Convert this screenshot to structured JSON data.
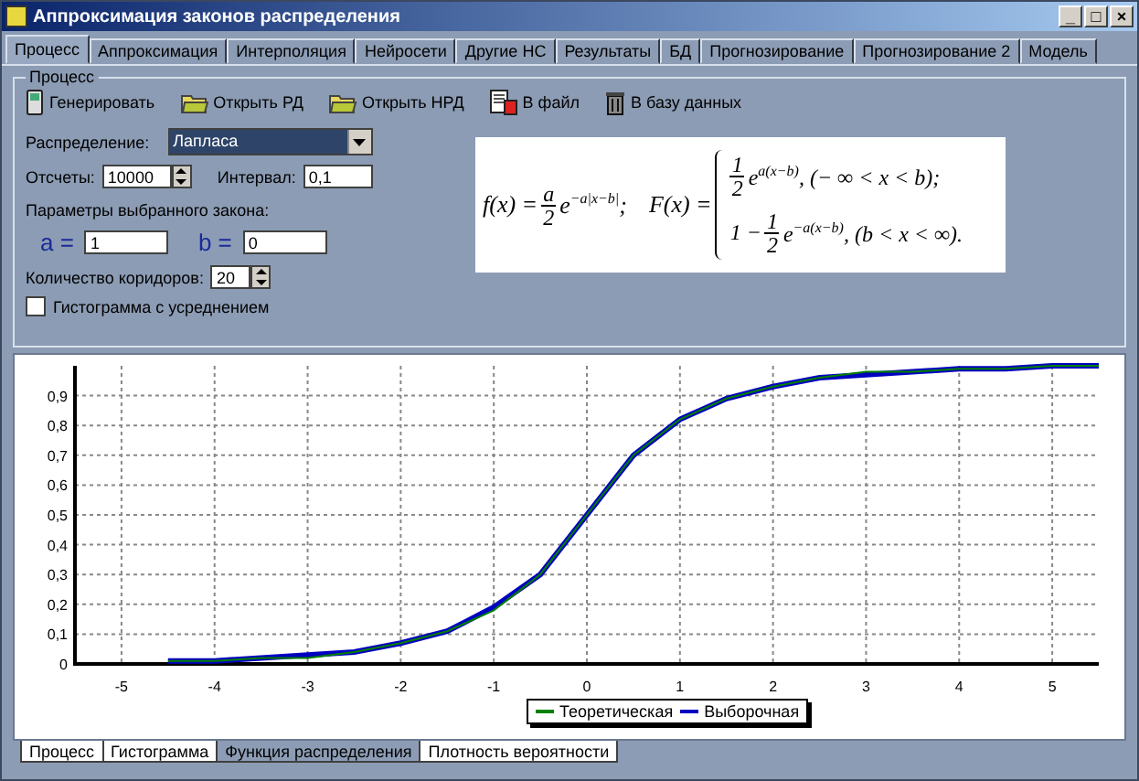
{
  "window": {
    "title": "Аппроксимация законов распределения",
    "controls": [
      "_",
      "□",
      "×"
    ]
  },
  "tabs": [
    {
      "label": "Процесс",
      "selected": true
    },
    {
      "label": "Аппроксимация",
      "selected": false
    },
    {
      "label": "Интерполяция",
      "selected": false
    },
    {
      "label": "Нейросети",
      "selected": false
    },
    {
      "label": "Другие НС",
      "selected": false
    },
    {
      "label": "Результаты",
      "selected": false
    },
    {
      "label": "БД",
      "selected": false
    },
    {
      "label": "Прогнозирование",
      "selected": false
    },
    {
      "label": "Прогнозирование 2",
      "selected": false
    },
    {
      "label": "Модель",
      "selected": false
    }
  ],
  "group": {
    "title": "Процесс",
    "toolbar": [
      {
        "kind": "phone",
        "label": "Генерировать"
      },
      {
        "kind": "folder",
        "label": "Открыть РД"
      },
      {
        "kind": "folder",
        "label": "Открыть НРД"
      },
      {
        "kind": "file",
        "label": "В файл"
      },
      {
        "kind": "bin",
        "label": "В базу данных"
      }
    ],
    "distribution": {
      "label": "Распределение:",
      "value": "Лапласа"
    },
    "samples": {
      "label": "Отсчеты:",
      "value": "10000"
    },
    "interval": {
      "label": "Интервал:",
      "value": "0,1"
    },
    "params_title": "Параметры выбранного закона:",
    "params": [
      {
        "name": "a =",
        "value": "1"
      },
      {
        "name": "b =",
        "value": "0"
      }
    ],
    "corridors": {
      "label": "Количество коридоров:",
      "value": "20"
    },
    "averaging": {
      "label": "Гистограмма с усреднением",
      "checked": false
    },
    "formula": {
      "f_lhs": "f(x) =",
      "f_num": "a",
      "f_den": "2",
      "f_base": "e",
      "f_exp": "−a|x−b|",
      "f_end": ";",
      "F_lhs": "F(x) =",
      "cases": [
        {
          "num": "1",
          "den": "2",
          "base": "e",
          "exp": "a(x−b)",
          "cond": ", (− ∞ < x < b);"
        },
        {
          "pre": "1 −",
          "num": "1",
          "den": "2",
          "base": "e",
          "exp": "−a(x−b)",
          "cond": ", (b < x < ∞)."
        }
      ]
    }
  },
  "chart_data": {
    "type": "line",
    "grid": true,
    "xlim": [
      -5.5,
      5.5
    ],
    "ylim": [
      0,
      1
    ],
    "xticks": [
      -5,
      -4,
      -3,
      -2,
      -1,
      0,
      1,
      2,
      3,
      4,
      5
    ],
    "yticks": [
      {
        "value": 0,
        "label": "0"
      },
      {
        "value": 0.1,
        "label": "0,1"
      },
      {
        "value": 0.2,
        "label": "0,2"
      },
      {
        "value": 0.3,
        "label": "0,3"
      },
      {
        "value": 0.4,
        "label": "0,4"
      },
      {
        "value": 0.5,
        "label": "0,5"
      },
      {
        "value": 0.6,
        "label": "0,6"
      },
      {
        "value": 0.7,
        "label": "0,7"
      },
      {
        "value": 0.8,
        "label": "0,8"
      },
      {
        "value": 0.9,
        "label": "0,9"
      }
    ],
    "x": [
      -4.5,
      -4,
      -3.5,
      -3,
      -2.5,
      -2,
      -1.5,
      -1,
      -0.5,
      0,
      0.5,
      1,
      1.5,
      2,
      2.5,
      3,
      3.5,
      4,
      4.5,
      5,
      5.5
    ],
    "series": [
      {
        "name": "Теоретическая",
        "color": "#008000",
        "values": [
          0.01,
          0.01,
          0.02,
          0.02,
          0.04,
          0.07,
          0.11,
          0.18,
          0.3,
          0.5,
          0.7,
          0.82,
          0.89,
          0.93,
          0.96,
          0.98,
          0.98,
          0.99,
          0.99,
          1.0,
          1.0
        ]
      },
      {
        "name": "Выборочная",
        "color": "#0000c0",
        "values": [
          0.01,
          0.01,
          0.02,
          0.03,
          0.04,
          0.07,
          0.11,
          0.19,
          0.3,
          0.5,
          0.7,
          0.82,
          0.89,
          0.93,
          0.96,
          0.97,
          0.98,
          0.99,
          0.99,
          1.0,
          1.0
        ]
      }
    ]
  },
  "bottom_tabs": [
    {
      "label": "Процесс",
      "selected": false
    },
    {
      "label": "Гистограмма",
      "selected": false
    },
    {
      "label": "Функция распределения",
      "selected": true
    },
    {
      "label": "Плотность вероятности",
      "selected": false
    }
  ]
}
